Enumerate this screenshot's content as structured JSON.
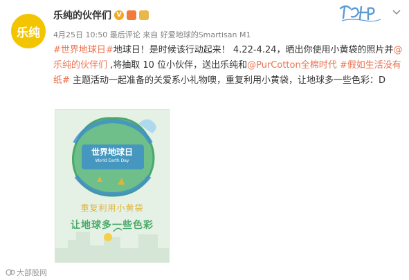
{
  "post": {
    "avatar_text": "乐纯",
    "username": "乐纯的伙伴们",
    "verified_badge": "V",
    "timestamp": "4月25日 10:50",
    "status": "最后评论",
    "source_prefix": "来自",
    "source": "好爱地球的Smartisan M1",
    "text": {
      "tag1": "#世界地球日#",
      "part1": "地球日！是时候该行动起来！ 4.22-4.24，晒出你使用小黄袋的照片并",
      "mention1": "@乐纯的伙伴们",
      "part2": " ,将抽取 10 位小伙伴，送出乐纯和",
      "mention2": "@PurCotton全棉时代",
      "part3": " ",
      "tag2": "#假如生活没有纸#",
      "part4": " 主题活动一起准备的关爱系小礼物噢，重复利用小黄袋，让地球多一些色彩：D"
    },
    "image": {
      "globe_title": "世界地球日",
      "globe_subtitle": "World Earth Day",
      "line1": "重复利用小黄袋",
      "line2": "让地球多一些色彩"
    }
  },
  "watermark": "大部股网",
  "icons": [
    "verified-icon",
    "member-badge-icon",
    "brand-badge-icon",
    "chevron-down-icon",
    "brand-script-logo"
  ],
  "colors": {
    "link": "#eb7350",
    "avatar_bg": "#f3c500",
    "meta": "#808080",
    "image_green": "#4aa86a"
  }
}
